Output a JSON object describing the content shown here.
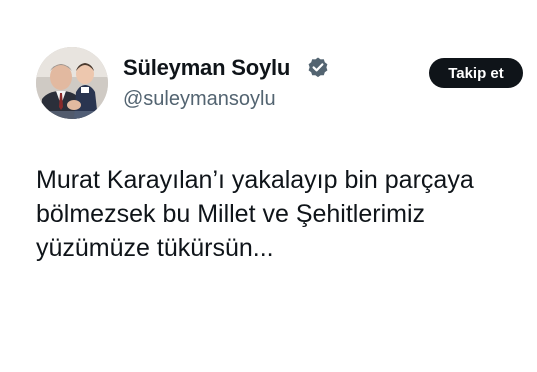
{
  "author": {
    "display_name": "Süleyman Soylu",
    "handle": "@suleymansoylu",
    "verified": true,
    "verified_icon": "verified-badge-icon",
    "verified_color": "#536471"
  },
  "follow_button": {
    "label": "Takip et",
    "background": "#0f1419",
    "text_color": "#ffffff"
  },
  "tweet": {
    "lines": [
      "Murat Karayılan’ı yakalayıp bin parçaya",
      "bölmezsek bu Millet ve Şehitlerimiz",
      "yüzümüze tükürsün..."
    ]
  }
}
